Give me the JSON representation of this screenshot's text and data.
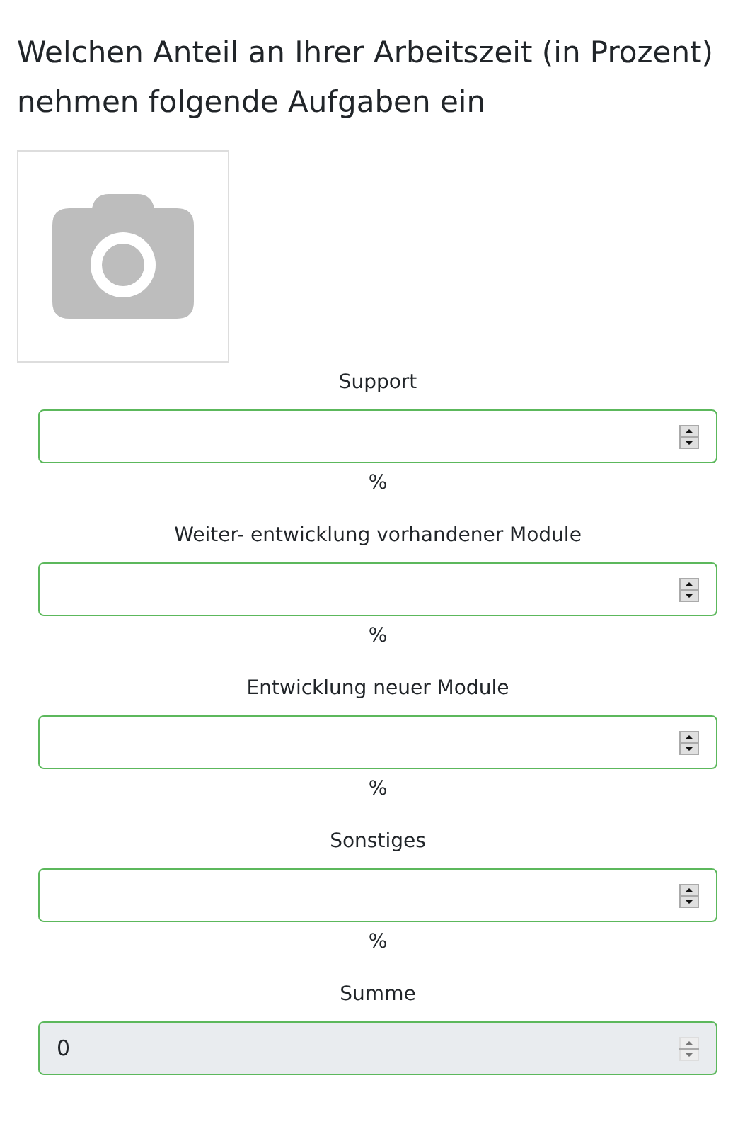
{
  "question": {
    "title": "Welchen Anteil an Ihrer Arbeitszeit (in Prozent) nehmen folgende Aufgaben ein"
  },
  "fields": [
    {
      "label": "Support",
      "unit": "%",
      "disabled": false
    },
    {
      "label": "Weiter- entwicklung vorhandener Module",
      "unit": "%",
      "disabled": false
    },
    {
      "label": "Entwicklung neuer Module",
      "unit": "%",
      "disabled": false
    },
    {
      "label": "Sonstiges",
      "unit": "%",
      "disabled": false
    },
    {
      "label": "Summe",
      "value": "0",
      "disabled": true
    }
  ]
}
